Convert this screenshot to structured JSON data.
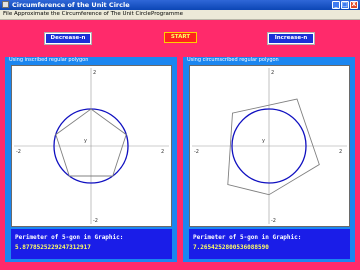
{
  "window": {
    "title": "Circumference of the Unit Circle",
    "controls": [
      "_",
      "□",
      "X"
    ]
  },
  "menu": {
    "items": [
      "File",
      "Approximate the Circumference of The Unit Circle",
      "Programme"
    ]
  },
  "toolbar": {
    "decrease_label": "Decrease-n",
    "start_label": "START",
    "increase_label": "Increase-n"
  },
  "left_panel": {
    "title": "Using inscribed regular polygon",
    "axis": {
      "x_min": "-2",
      "x_max": "2",
      "y_label": "y",
      "y_max": "2",
      "y_min": "-2"
    },
    "perimeter_label": "Perimeter of 5-gon in Graphic:",
    "perimeter_value": "5.8778525229247312917"
  },
  "right_panel": {
    "title": "Using circumscribed regular polygon",
    "axis": {
      "x_min": "-2",
      "x_max": "2",
      "y_label": "y",
      "y_max": "2",
      "y_min": "-2"
    },
    "perimeter_label": "Perimeter of 5-gon in Graphic:",
    "perimeter_value": "7.2654252800536088590"
  },
  "colors": {
    "background": "#ff2a6b",
    "panel": "#1b86f0",
    "circle": "#1010c0",
    "polygon": "#808080",
    "info_bg": "#1a1de8",
    "value_text": "#ffff66"
  }
}
